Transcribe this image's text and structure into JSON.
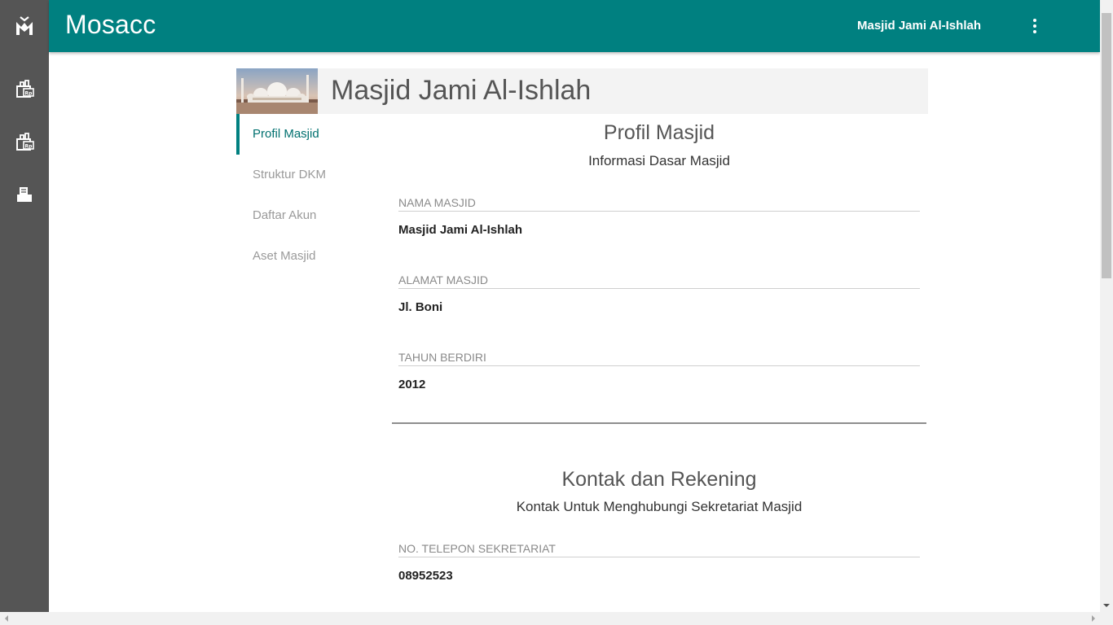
{
  "app": {
    "brand": "Mosacc",
    "user_name": "Masjid Jami Al-Ishlah"
  },
  "rail": {
    "items": [
      {
        "icon": "mosque-logo-icon"
      },
      {
        "icon": "donation-receipt-icon"
      },
      {
        "icon": "expense-receipt-icon"
      },
      {
        "icon": "report-icon"
      }
    ]
  },
  "header": {
    "title": "Masjid Jami Al-Ishlah"
  },
  "tabs": [
    {
      "label": "Profil Masjid",
      "active": true
    },
    {
      "label": "Struktur DKM",
      "active": false
    },
    {
      "label": "Daftar Akun",
      "active": false
    },
    {
      "label": "Aset Masjid",
      "active": false
    }
  ],
  "profile": {
    "title": "Profil Masjid",
    "subtitle": "Informasi Dasar Masjid",
    "fields": [
      {
        "label": "NAMA MASJID",
        "value": "Masjid Jami Al-Ishlah"
      },
      {
        "label": "ALAMAT MASJID",
        "value": "Jl. Boni"
      },
      {
        "label": "TAHUN BERDIRI",
        "value": "2012"
      }
    ]
  },
  "contact": {
    "title": "Kontak dan Rekening",
    "subtitle": "Kontak Untuk Menghubungi Sekretariat Masjid",
    "fields": [
      {
        "label": "NO. TELEPON SEKRETARIAT",
        "value": "08952523"
      }
    ]
  },
  "colors": {
    "primary": "#008080",
    "rail": "#555555"
  }
}
